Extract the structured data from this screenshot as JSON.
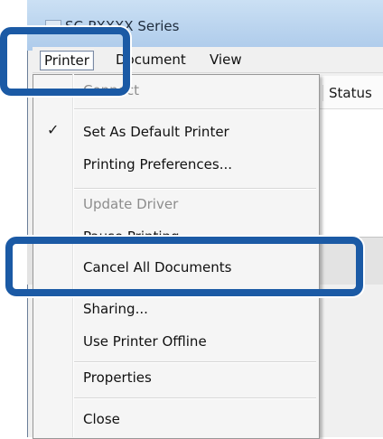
{
  "window": {
    "title": "SC-PXXXX Series"
  },
  "menubar": {
    "items": [
      {
        "label": "Printer"
      },
      {
        "label": "Document"
      },
      {
        "label": "View"
      }
    ]
  },
  "list": {
    "columns": [
      "Status"
    ]
  },
  "printer_menu": {
    "items": [
      {
        "label": "Connect",
        "enabled": true
      },
      {
        "label": "Set As Default Printer",
        "checked": true
      },
      {
        "label": "Printing Preferences..."
      },
      {
        "label": "Update Driver",
        "enabled": false
      },
      {
        "label": "Pause Printing"
      },
      {
        "label": "Cancel All Documents"
      },
      {
        "label": "Sharing..."
      },
      {
        "label": "Use Printer Offline"
      },
      {
        "label": "Properties"
      },
      {
        "label": "Close"
      }
    ]
  },
  "highlights": {
    "color": "#1b5aa5",
    "targets": [
      "Printer",
      "Cancel All Documents"
    ]
  }
}
